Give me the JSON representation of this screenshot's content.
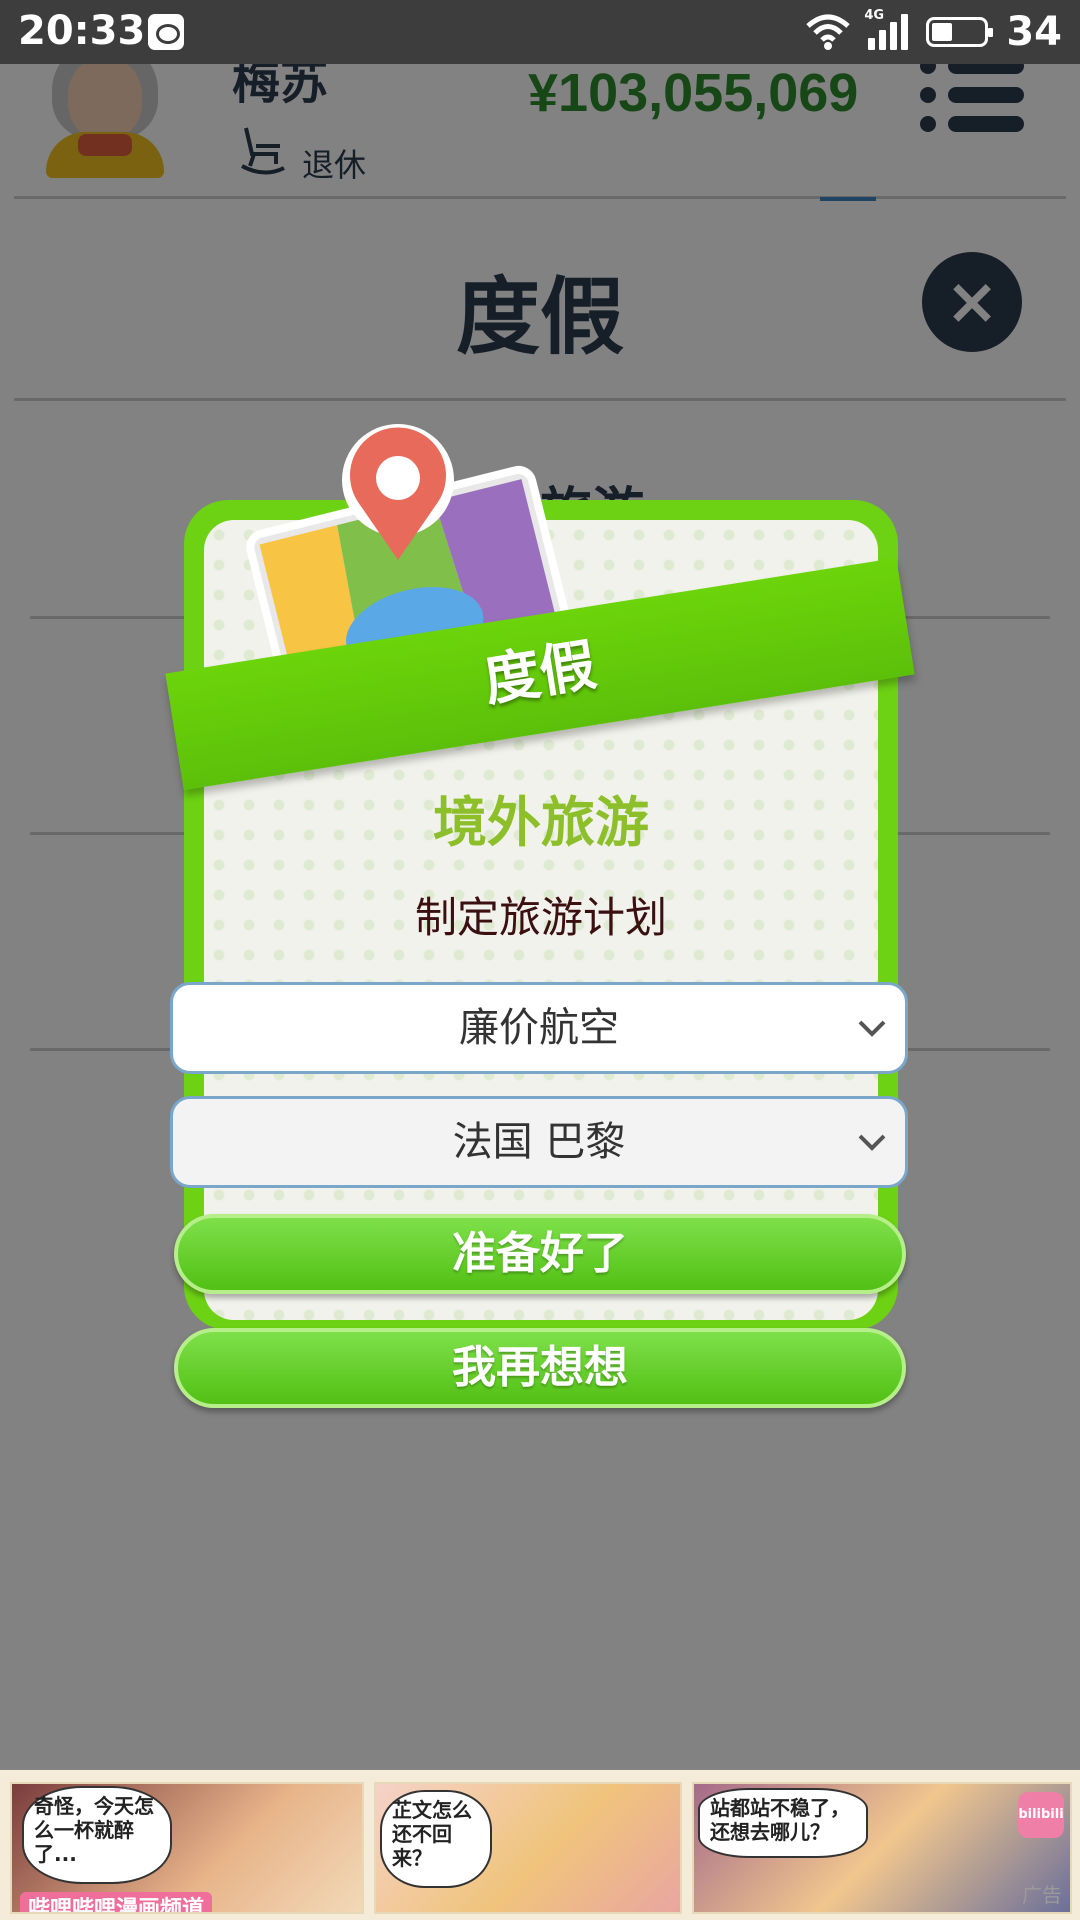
{
  "status_bar": {
    "time": "20:33",
    "network": "4G",
    "battery_percent": "34",
    "icons": [
      "weibo-icon",
      "wifi-icon",
      "signal-icon",
      "battery-icon"
    ]
  },
  "profile": {
    "name": "梅苏",
    "status": "退休",
    "money": "¥103,055,069"
  },
  "page": {
    "title": "度假",
    "partial_item": "旅游"
  },
  "dialog": {
    "ribbon_label": "度假",
    "title": "境外旅游",
    "subtitle": "制定旅游计划",
    "airline_select": {
      "selected": "廉价航空"
    },
    "destination_select": {
      "selected": "法国 巴黎"
    },
    "confirm_label": "准备好了",
    "cancel_label": "我再想想"
  },
  "ad": {
    "panels": [
      {
        "bubble": "奇怪，今天怎么一杯就醉了..."
      },
      {
        "bubble": "芷文怎么还不回来？"
      },
      {
        "bubble": "站都站不稳了，还想去哪儿？"
      }
    ],
    "channel": "哔哩哔哩漫画频道",
    "logo_text": "bilibili",
    "label": "广告"
  },
  "colors": {
    "accent_green": "#6dd214",
    "money_green": "#2e8b2e",
    "title_dark": "#2c3e50",
    "dialog_title": "#8dbf2a"
  }
}
